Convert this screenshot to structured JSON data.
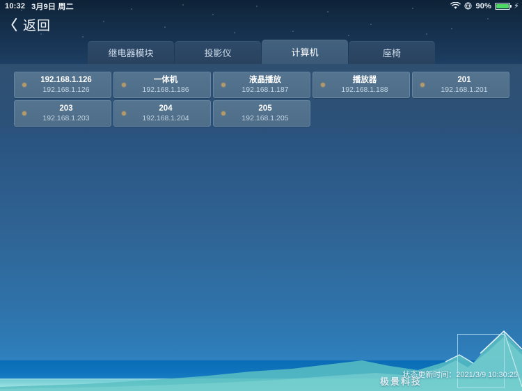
{
  "status_bar": {
    "time": "10:32",
    "date": "3月9日 周二",
    "battery_percent": "90%",
    "wifi_icon": "wifi-icon",
    "location_icon": "location-icon",
    "battery_icon": "battery-icon",
    "charging_icon": "charging-plug-icon"
  },
  "nav": {
    "back_label": "返回",
    "back_icon": "chevron-left-icon"
  },
  "tabs": [
    {
      "label": "继电器模块",
      "active": false
    },
    {
      "label": "投影仪",
      "active": false
    },
    {
      "label": "计算机",
      "active": true
    },
    {
      "label": "座椅",
      "active": false
    }
  ],
  "devices": [
    {
      "name": "192.168.1.126",
      "ip": "192.168.1.126",
      "status_color": "#b49a6a"
    },
    {
      "name": "一体机",
      "ip": "192.168.1.186",
      "status_color": "#b49a6a"
    },
    {
      "name": "液晶播放",
      "ip": "192.168.1.187",
      "status_color": "#b49a6a"
    },
    {
      "name": "播放器",
      "ip": "192.168.1.188",
      "status_color": "#b49a6a"
    },
    {
      "name": "201",
      "ip": "192.168.1.201",
      "status_color": "#b49a6a"
    },
    {
      "name": "203",
      "ip": "192.168.1.203",
      "status_color": "#b49a6a"
    },
    {
      "name": "204",
      "ip": "192.168.1.204",
      "status_color": "#b49a6a"
    },
    {
      "name": "205",
      "ip": "192.168.1.205",
      "status_color": "#b49a6a"
    }
  ],
  "footer": {
    "brand": "极景科技",
    "updated_text": "状态更新时间：2021/3/9 10:30:25",
    "logo_icon": "mountain-logo-icon"
  },
  "theme": {
    "accent": "#b49a6a",
    "tab_active_bg": "#43627f",
    "tab_bg": "#2d4a69",
    "card_bg": "#55748f",
    "battery_green": "#4cd964"
  }
}
